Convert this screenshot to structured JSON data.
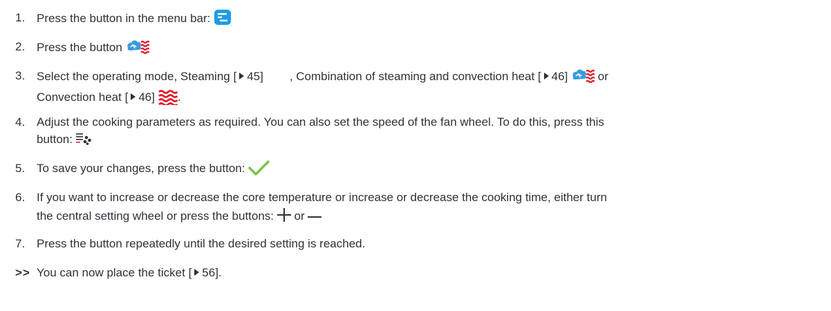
{
  "colors": {
    "text": "#2d3237",
    "menu_blue": "#1e9be6",
    "steam_blue": "#3a9be0",
    "heat_red": "#e0202d",
    "check_green": "#7cc34a"
  },
  "icons": {
    "menu": "menu-bar-icon",
    "combi": "combination-steam-convection-icon",
    "heat": "convection-heat-icon",
    "fan": "fan-speed-icon",
    "check": "checkmark-icon",
    "plus": "plus-icon",
    "minus": "minus-icon"
  },
  "steps": [
    {
      "num": "1.",
      "text": "Press the button in the menu bar:"
    },
    {
      "num": "2.",
      "text": "Press the button"
    },
    {
      "num": "3.",
      "a": "Select the operating mode, Steaming [",
      "ref1": "45]",
      "b": ", Combination of steaming and convection heat [",
      "ref2": "46]",
      "c": "or",
      "d": "Convection heat [",
      "ref3": "46]",
      "e": "."
    },
    {
      "num": "4.",
      "line1": "Adjust the cooking parameters as required. You can also set the speed of the fan wheel. To do this, press this",
      "line2": "button:"
    },
    {
      "num": "5.",
      "text": "To save your changes, press the button:"
    },
    {
      "num": "6.",
      "line1": "If you want to increase or decrease the core temperature or increase or decrease the cooking time, either turn",
      "line2": "the central setting wheel or press the buttons:",
      "or": "or"
    },
    {
      "num": "7.",
      "text": "Press the button repeatedly until the desired setting is reached."
    }
  ],
  "result": {
    "marker": ">>",
    "text": "You can now place the ticket [",
    "ref": "56]."
  }
}
